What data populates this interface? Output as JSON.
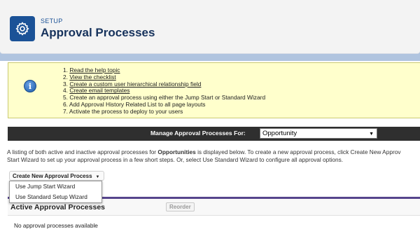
{
  "header": {
    "section_label": "SETUP",
    "title": "Approval Processes",
    "icon": "gear-icon"
  },
  "info": {
    "icon": "info-icon",
    "steps": [
      {
        "num": "1.",
        "text": "Read the help topic",
        "link": true
      },
      {
        "num": "2.",
        "text": "View the checklist",
        "link": true
      },
      {
        "num": "3.",
        "text": "Create a custom user hierarchical relationship field",
        "link": true
      },
      {
        "num": "4.",
        "text": "Create email templates",
        "link": true
      },
      {
        "num": "5.",
        "text": "Create an approval process using either the Jump Start or Standard Wizard",
        "link": false
      },
      {
        "num": "6.",
        "text": "Add Approval History Related List to all page layouts",
        "link": false
      },
      {
        "num": "7.",
        "text": "Activate the process to deploy to your users",
        "link": false
      }
    ]
  },
  "manage": {
    "label": "Manage Approval Processes For:",
    "selected": "Opportunity"
  },
  "description": {
    "line1_prefix": "A listing of both active and inactive approval processes for ",
    "line1_object": "Opportunities",
    "line1_suffix": " is displayed below. To create a new approval process, click Create New Approv",
    "line2": "Start Wizard to set up your approval process in a few short steps. Or, select Use Standard Wizard to configure all approval options."
  },
  "create_button": {
    "label": "Create New Approval Process",
    "caret": "▼"
  },
  "dropdown": {
    "items": [
      "Use Jump Start Wizard",
      "Use Standard Setup Wizard"
    ]
  },
  "active_panel": {
    "title": "Active Approval Processes",
    "reorder_label": "Reorder",
    "empty_text": "No approval processes available"
  },
  "colors": {
    "background": "#b0c4df",
    "brand": "#1b5297",
    "info_bg": "#ffffcc",
    "manage_bar": "#2f2f2f",
    "panel_accent": "#56458c"
  }
}
